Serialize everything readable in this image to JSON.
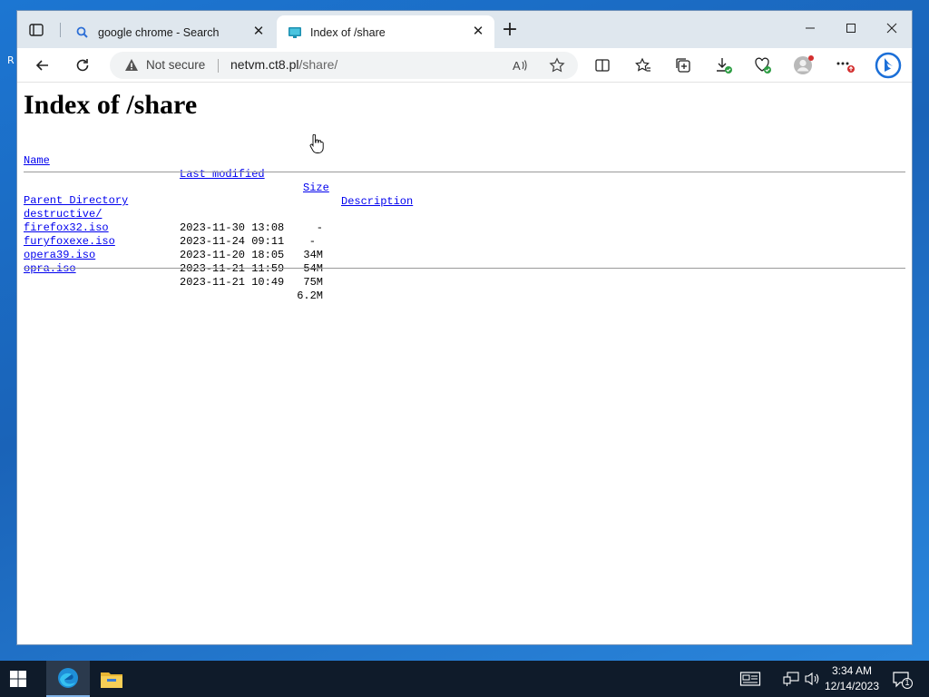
{
  "desktop": {
    "edge_text": "R"
  },
  "browser": {
    "tabs": [
      {
        "title": "google chrome - Search",
        "favicon": "search-icon",
        "active": false
      },
      {
        "title": "Index of /share",
        "favicon": "monitor-icon",
        "active": true
      }
    ],
    "close_glyph": "✕",
    "new_tab_glyph": "+",
    "window_controls": {
      "minimize": "—",
      "maximize": "☐",
      "close": "✕"
    },
    "address_bar": {
      "security_label": "Not secure",
      "url_host": "netvm.ct8.pl",
      "url_path": "/share/"
    }
  },
  "page": {
    "heading": "Index of /share",
    "columns": {
      "name": "Name",
      "modified": "Last modified",
      "size": "Size",
      "description": "Description"
    },
    "entries": [
      {
        "name": "Parent Directory",
        "modified": "",
        "size": "-",
        "description": ""
      },
      {
        "name": "destructive/",
        "modified": "2023-11-30 13:08",
        "size": "-",
        "description": ""
      },
      {
        "name": "firefox32.iso",
        "modified": "2023-11-24 09:11",
        "size": "34M",
        "description": ""
      },
      {
        "name": "furyfoxexe.iso",
        "modified": "2023-11-20 18:05",
        "size": "54M",
        "description": ""
      },
      {
        "name": "opera39.iso",
        "modified": "2023-11-21 11:59",
        "size": "75M",
        "description": ""
      },
      {
        "name": "opra.iso",
        "modified": "2023-11-21 10:49",
        "size": "6.2M",
        "description": ""
      }
    ]
  },
  "taskbar": {
    "apps": [
      "edge-icon",
      "file-explorer-icon"
    ],
    "clock": {
      "time": "3:34 AM",
      "date": "12/14/2023"
    },
    "notification_count": "1"
  },
  "colors": {
    "link": "#0000ee",
    "taskbar": "#0f1b2a",
    "desktop": "#1a6cc4",
    "edge_profile_badge": "#d32f2f"
  }
}
